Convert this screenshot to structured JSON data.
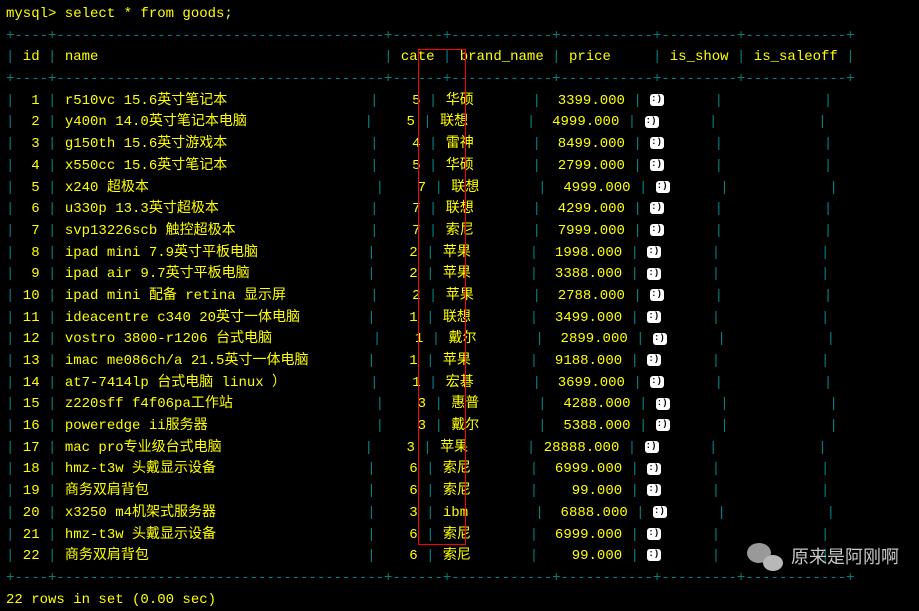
{
  "prompt": "mysql> select * from goods;",
  "separator": "+----+---------------------------------------+------+------------+-----------+---------+------------+",
  "columns": [
    "id",
    "name",
    "cate",
    "brand_name",
    "price",
    "is_show",
    "is_saleoff"
  ],
  "rows": [
    {
      "id": "1",
      "name": "r510vc 15.6英寸笔记本",
      "cate": "5",
      "brand_name": "华硕",
      "price": "3399.000",
      "is_show_icon": true
    },
    {
      "id": "2",
      "name": "y400n 14.0英寸笔记本电脑",
      "cate": "5",
      "brand_name": "联想",
      "price": "4999.000",
      "is_show_icon": true
    },
    {
      "id": "3",
      "name": "g150th 15.6英寸游戏本",
      "cate": "4",
      "brand_name": "雷神",
      "price": "8499.000",
      "is_show_icon": true
    },
    {
      "id": "4",
      "name": "x550cc 15.6英寸笔记本",
      "cate": "5",
      "brand_name": "华硕",
      "price": "2799.000",
      "is_show_icon": true
    },
    {
      "id": "5",
      "name": "x240 超极本",
      "cate": "7",
      "brand_name": "联想",
      "price": "4999.000",
      "is_show_icon": true
    },
    {
      "id": "6",
      "name": "u330p 13.3英寸超极本",
      "cate": "7",
      "brand_name": "联想",
      "price": "4299.000",
      "is_show_icon": true
    },
    {
      "id": "7",
      "name": "svp13226scb 触控超极本",
      "cate": "7",
      "brand_name": "索尼",
      "price": "7999.000",
      "is_show_icon": true
    },
    {
      "id": "8",
      "name": "ipad mini 7.9英寸平板电脑",
      "cate": "2",
      "brand_name": "苹果",
      "price": "1998.000",
      "is_show_icon": true
    },
    {
      "id": "9",
      "name": "ipad air 9.7英寸平板电脑",
      "cate": "2",
      "brand_name": "苹果",
      "price": "3388.000",
      "is_show_icon": true
    },
    {
      "id": "10",
      "name": "ipad mini 配备 retina 显示屏",
      "cate": "2",
      "brand_name": "苹果",
      "price": "2788.000",
      "is_show_icon": true
    },
    {
      "id": "11",
      "name": "ideacentre c340 20英寸一体电脑",
      "cate": "1",
      "brand_name": "联想",
      "price": "3499.000",
      "is_show_icon": true
    },
    {
      "id": "12",
      "name": "vostro 3800-r1206 台式电脑",
      "cate": "1",
      "brand_name": "戴尔",
      "price": "2899.000",
      "is_show_icon": true
    },
    {
      "id": "13",
      "name": "imac me086ch/a 21.5英寸一体电脑",
      "cate": "1",
      "brand_name": "苹果",
      "price": "9188.000",
      "is_show_icon": true
    },
    {
      "id": "14",
      "name": "at7-7414lp 台式电脑 linux ）",
      "cate": "1",
      "brand_name": "宏碁",
      "price": "3699.000",
      "is_show_icon": true
    },
    {
      "id": "15",
      "name": "z220sff f4f06pa工作站",
      "cate": "3",
      "brand_name": "惠普",
      "price": "4288.000",
      "is_show_icon": true
    },
    {
      "id": "16",
      "name": "poweredge ii服务器",
      "cate": "3",
      "brand_name": "戴尔",
      "price": "5388.000",
      "is_show_icon": true
    },
    {
      "id": "17",
      "name": "mac pro专业级台式电脑",
      "cate": "3",
      "brand_name": "苹果",
      "price": "28888.000",
      "is_show_icon": true
    },
    {
      "id": "18",
      "name": "hmz-t3w 头戴显示设备",
      "cate": "6",
      "brand_name": "索尼",
      "price": "6999.000",
      "is_show_icon": true
    },
    {
      "id": "19",
      "name": "商务双肩背包",
      "cate": "6",
      "brand_name": "索尼",
      "price": "99.000",
      "is_show_icon": true
    },
    {
      "id": "20",
      "name": "x3250 m4机架式服务器",
      "cate": "3",
      "brand_name": "ibm",
      "price": "6888.000",
      "is_show_icon": true
    },
    {
      "id": "21",
      "name": "hmz-t3w 头戴显示设备",
      "cate": "6",
      "brand_name": "索尼",
      "price": "6999.000",
      "is_show_icon": true
    },
    {
      "id": "22",
      "name": "商务双肩背包",
      "cate": "6",
      "brand_name": "索尼",
      "price": "99.000",
      "is_show_icon": true
    }
  ],
  "footer": "22 rows in set (0.00 sec)",
  "watermark_text": "原来是阿刚啊",
  "col_widths": {
    "id": 4,
    "name": 39,
    "cate": 6,
    "brand_name": 12,
    "price": 11,
    "is_show": 9,
    "is_saleoff": 12
  }
}
